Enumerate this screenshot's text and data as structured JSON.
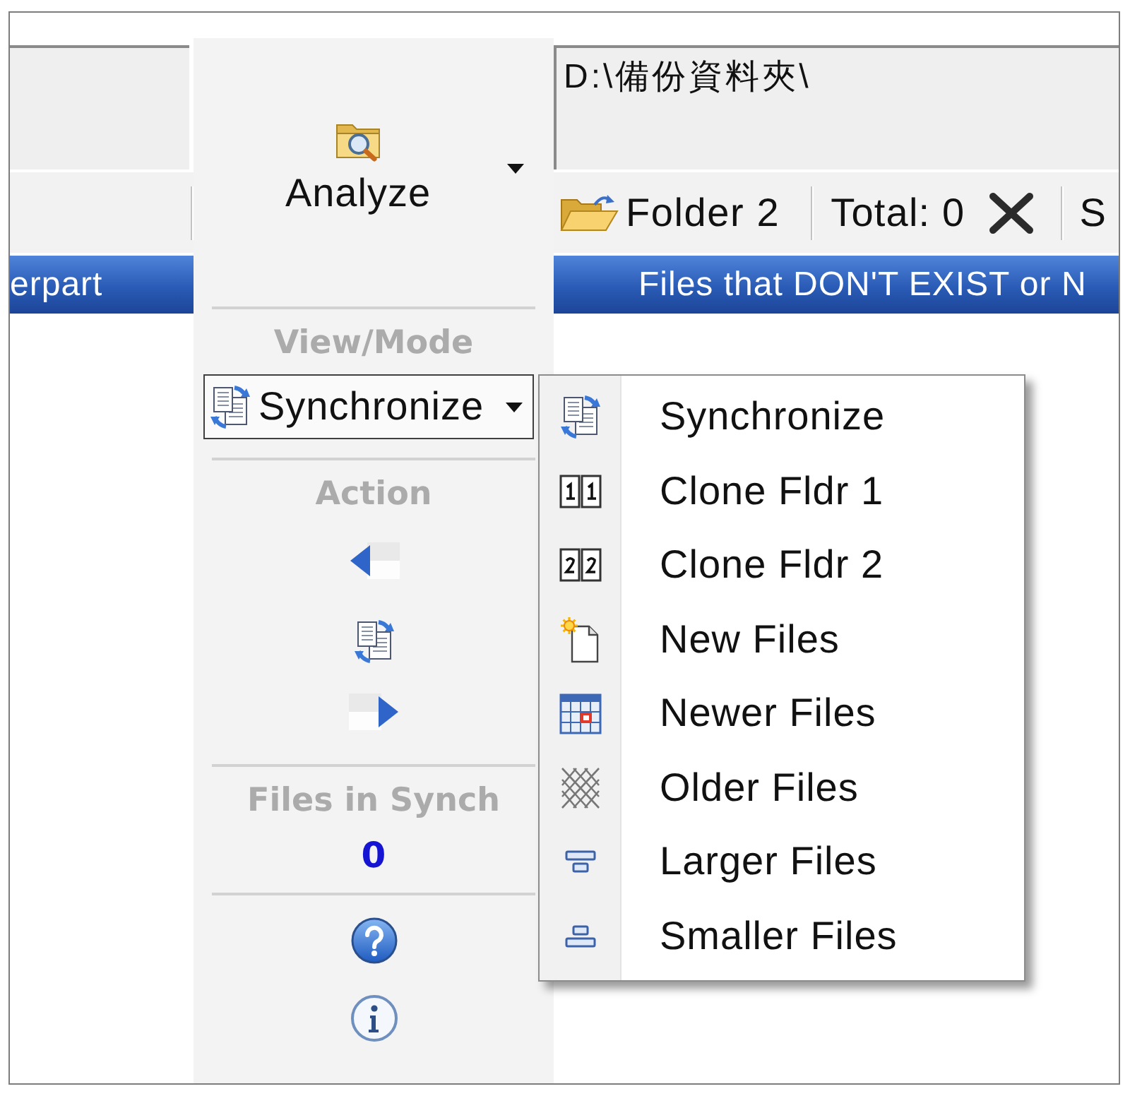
{
  "left_pane": {
    "column_header": "erpart"
  },
  "center_panel": {
    "analyze_button": {
      "label": "Analyze"
    },
    "view_mode": {
      "title": "View/Mode",
      "dropdown": {
        "value": "Synchronize",
        "expanded": true,
        "menu": [
          {
            "label": "Synchronize",
            "kind": "sync"
          },
          {
            "label": "Clone Fldr 1",
            "kind": "clone-first"
          },
          {
            "label": "Clone Fldr 2",
            "kind": "clone-second"
          },
          {
            "label": "New Files",
            "kind": "new"
          },
          {
            "label": "Newer Files",
            "kind": "newer"
          },
          {
            "label": "Older Files",
            "kind": "older"
          },
          {
            "label": "Larger Files",
            "kind": "larger"
          },
          {
            "label": "Smaller Files",
            "kind": "smaller"
          }
        ]
      }
    },
    "action": {
      "title": "Action"
    },
    "files_in_synch": {
      "title": "Files in Synch",
      "count": "0"
    }
  },
  "right_pane": {
    "path_field": {
      "value": "D:\\備份資料夾\\"
    },
    "toolbar": {
      "folder_button": {
        "label": "Folder 2"
      },
      "total": "Total: 0",
      "cut_off_item": "S"
    },
    "column_header": "Files that DON'T EXIST or N"
  }
}
